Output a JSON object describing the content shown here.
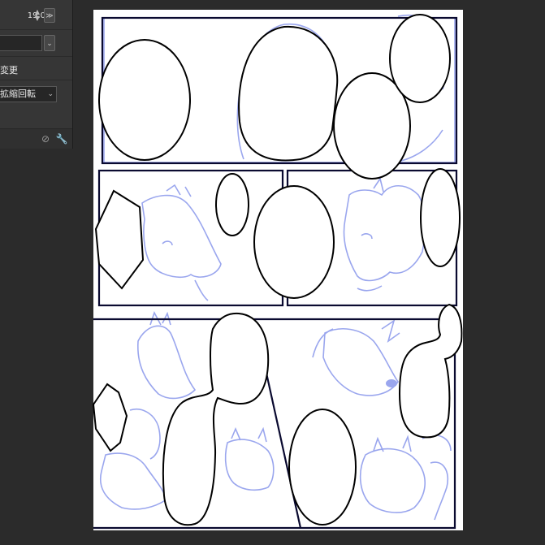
{
  "tool_panel": {
    "size_value": "19.0",
    "option_label_change": "変更",
    "transform_select_value": "拡縮回転",
    "spin_up_icon": "chevron-up-icon",
    "spin_down_icon": "chevron-down-icon"
  },
  "colors": {
    "canvas_bg": "#2b2b2b",
    "panel_bg": "#363636",
    "sketch_line": "#9aa6ee",
    "frame_line": "#0a0a30",
    "ink_line": "#000000",
    "page": "#ffffff"
  }
}
